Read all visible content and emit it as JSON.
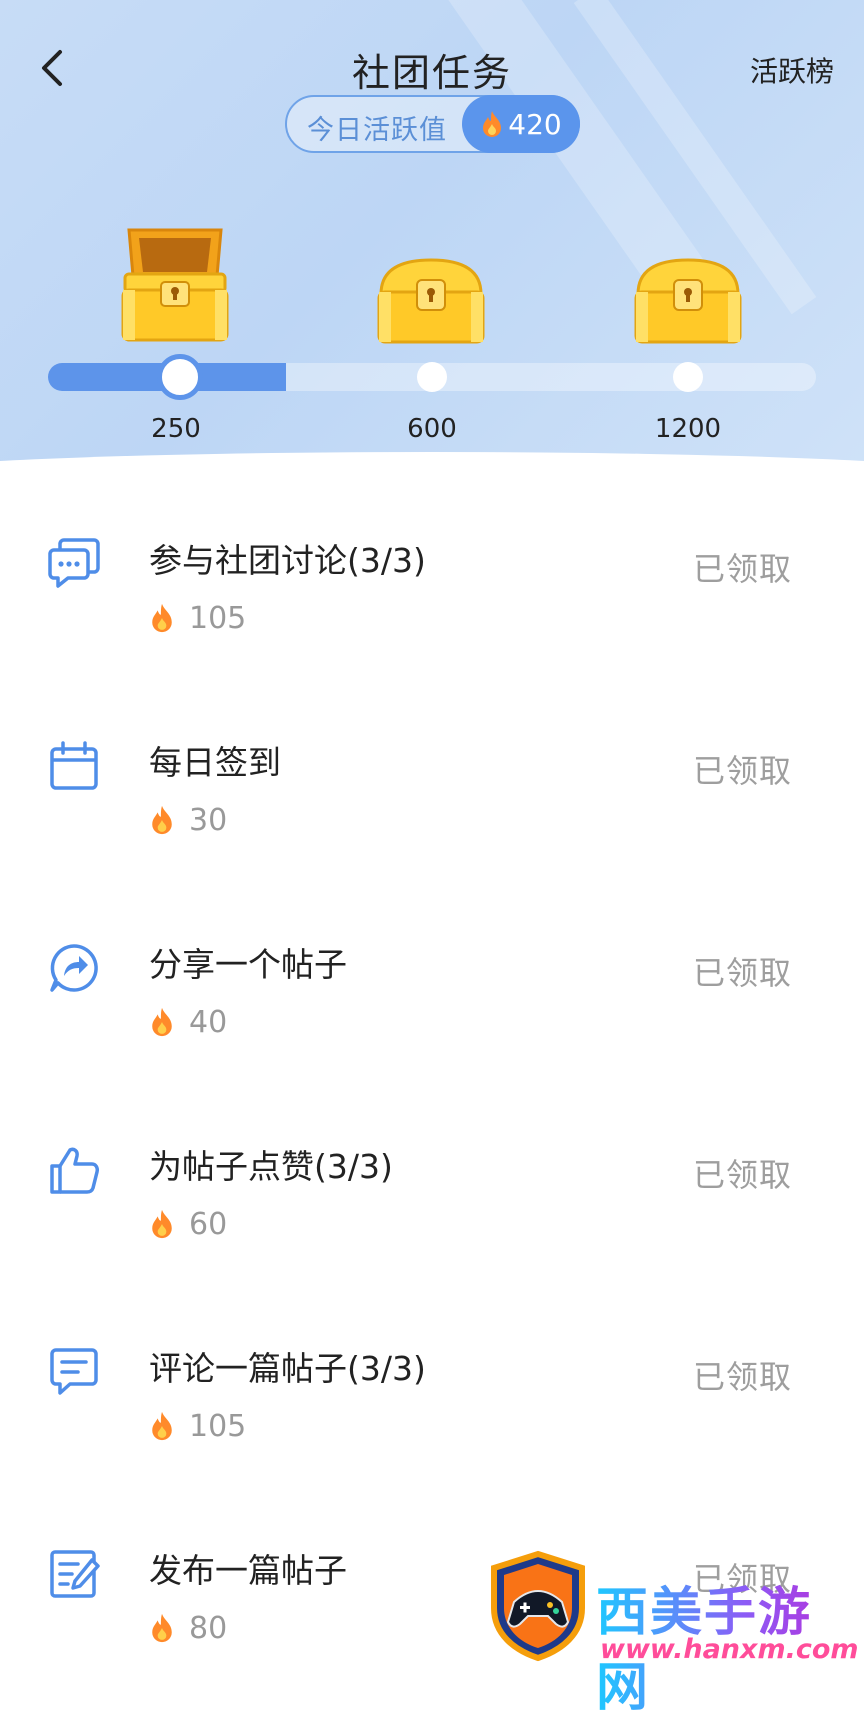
{
  "header": {
    "title": "社团任务",
    "rank_link": "活跃榜",
    "activity_label": "今日活跃值",
    "activity_value": "420"
  },
  "progress": {
    "current": 420,
    "milestones": [
      {
        "label": "250",
        "value": 250,
        "chest": "opened"
      },
      {
        "label": "600",
        "value": 600,
        "chest": "closed"
      },
      {
        "label": "1200",
        "value": 1200,
        "chest": "closed"
      }
    ],
    "fill_fraction": 0.31
  },
  "tasks": [
    {
      "title": "参与社团讨论(3/3)",
      "points": "105",
      "status": "已领取",
      "icon": "discussion-icon"
    },
    {
      "title": "每日签到",
      "points": "30",
      "status": "已领取",
      "icon": "calendar-icon"
    },
    {
      "title": "分享一个帖子",
      "points": "40",
      "status": "已领取",
      "icon": "share-icon"
    },
    {
      "title": "为帖子点赞(3/3)",
      "points": "60",
      "status": "已领取",
      "icon": "thumbs-up-icon"
    },
    {
      "title": "评论一篇帖子(3/3)",
      "points": "105",
      "status": "已领取",
      "icon": "comment-icon"
    },
    {
      "title": "发布一篇帖子",
      "points": "80",
      "status": "已领取",
      "icon": "edit-post-icon"
    }
  ],
  "watermark": {
    "name": "西美手游网",
    "url": "www.hanxm.com"
  },
  "colors": {
    "accent": "#5d94ea",
    "icon_blue": "#4f8de8",
    "flame": "#ff8a2a",
    "status_gray": "#9e9e9e"
  }
}
